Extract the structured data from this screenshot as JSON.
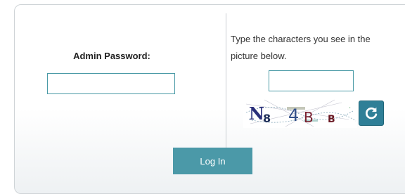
{
  "login_form": {
    "password_label": "Admin Password:",
    "password_value": "",
    "captcha_instructions": "Type the characters you see in the picture below.",
    "captcha_value": "",
    "captcha_image_text": "N8 4B B",
    "login_label": "Log In"
  },
  "icons": {
    "refresh": "refresh-icon"
  },
  "colors": {
    "accent": "#4b99a8",
    "input_border": "#4a9aa6",
    "refresh_button": "#2f7f97"
  }
}
